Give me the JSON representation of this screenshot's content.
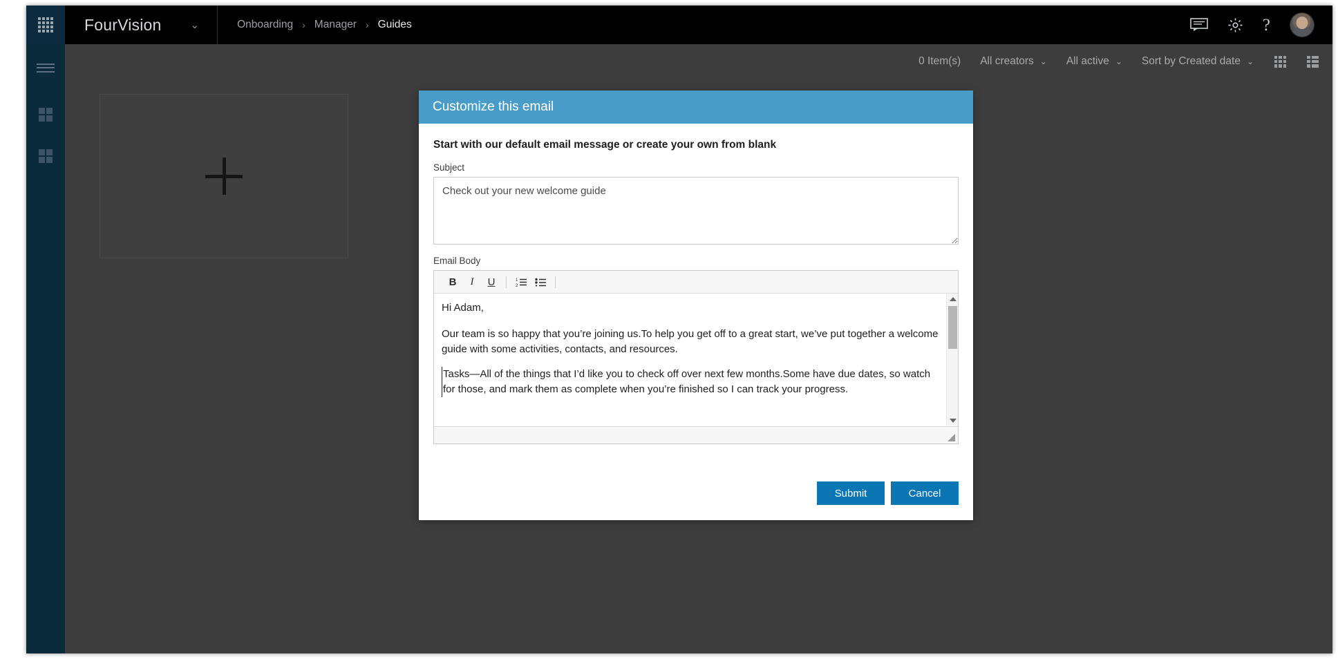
{
  "topbar": {
    "waffle_icon": "app-launcher-waffle-icon",
    "brand_name": "FourVision",
    "brand_caret": "⌄",
    "breadcrumb": [
      {
        "label": "Onboarding",
        "current": false
      },
      {
        "label": "Manager",
        "current": false
      },
      {
        "label": "Guides",
        "current": true
      }
    ],
    "breadcrumb_separator": "›",
    "icons": [
      {
        "name": "feedback-icon",
        "label": "Feedback"
      },
      {
        "name": "gear-icon",
        "label": "Settings"
      },
      {
        "name": "help-icon",
        "label": "?"
      }
    ],
    "avatar_name": "user-avatar"
  },
  "rail": {
    "items": [
      {
        "name": "hamburger-menu-icon",
        "label": "Menu"
      },
      {
        "name": "grid-quad-icon-1",
        "label": "Dashboard"
      },
      {
        "name": "grid-quad-icon-2",
        "label": "Modules"
      }
    ]
  },
  "filterbar": {
    "item_count": "0 Item(s)",
    "creators_filter": "All creators",
    "status_filter": "All active",
    "sort_filter": "Sort by Created date",
    "caret": "⌄",
    "grid_view_icon": "grid-view-icon",
    "list_view_icon": "list-view-icon"
  },
  "main": {
    "add_card_label": "+",
    "add_card_name": "add-guide-card"
  },
  "dialog": {
    "title": "Customize this email",
    "intro": "Start with our default email message or create your own from blank",
    "subject_label": "Subject",
    "subject_value": "Check out your new welcome guide",
    "subject_placeholder": "Check out your new welcome guide",
    "body_label": "Email Body",
    "toolbar": [
      {
        "name": "bold-icon",
        "label": "B"
      },
      {
        "name": "italic-icon",
        "label": "I"
      },
      {
        "name": "underline-icon",
        "label": "U"
      },
      {
        "name": "ordered-list-icon",
        "label": ""
      },
      {
        "name": "unordered-list-icon",
        "label": ""
      }
    ],
    "body_paragraphs": [
      "Hi Adam,",
      "Our team is so happy that you’re joining us.To help you get off to a great start, we’ve put together a welcome guide with some activities, contacts, and resources.",
      "Tasks—All of the things that I’d like you to check off over next few months.Some have due dates, so watch for those, and mark them as complete when you’re finished so I can track your progress."
    ],
    "submit_label": "Submit",
    "cancel_label": "Cancel"
  },
  "colors": {
    "dialog_header_blue": "#4a9cc8",
    "button_blue": "#0a76b4",
    "rail_navy": "#0b2a3b",
    "topbar_black": "#010101",
    "content_gray": "#3d3d3d"
  }
}
